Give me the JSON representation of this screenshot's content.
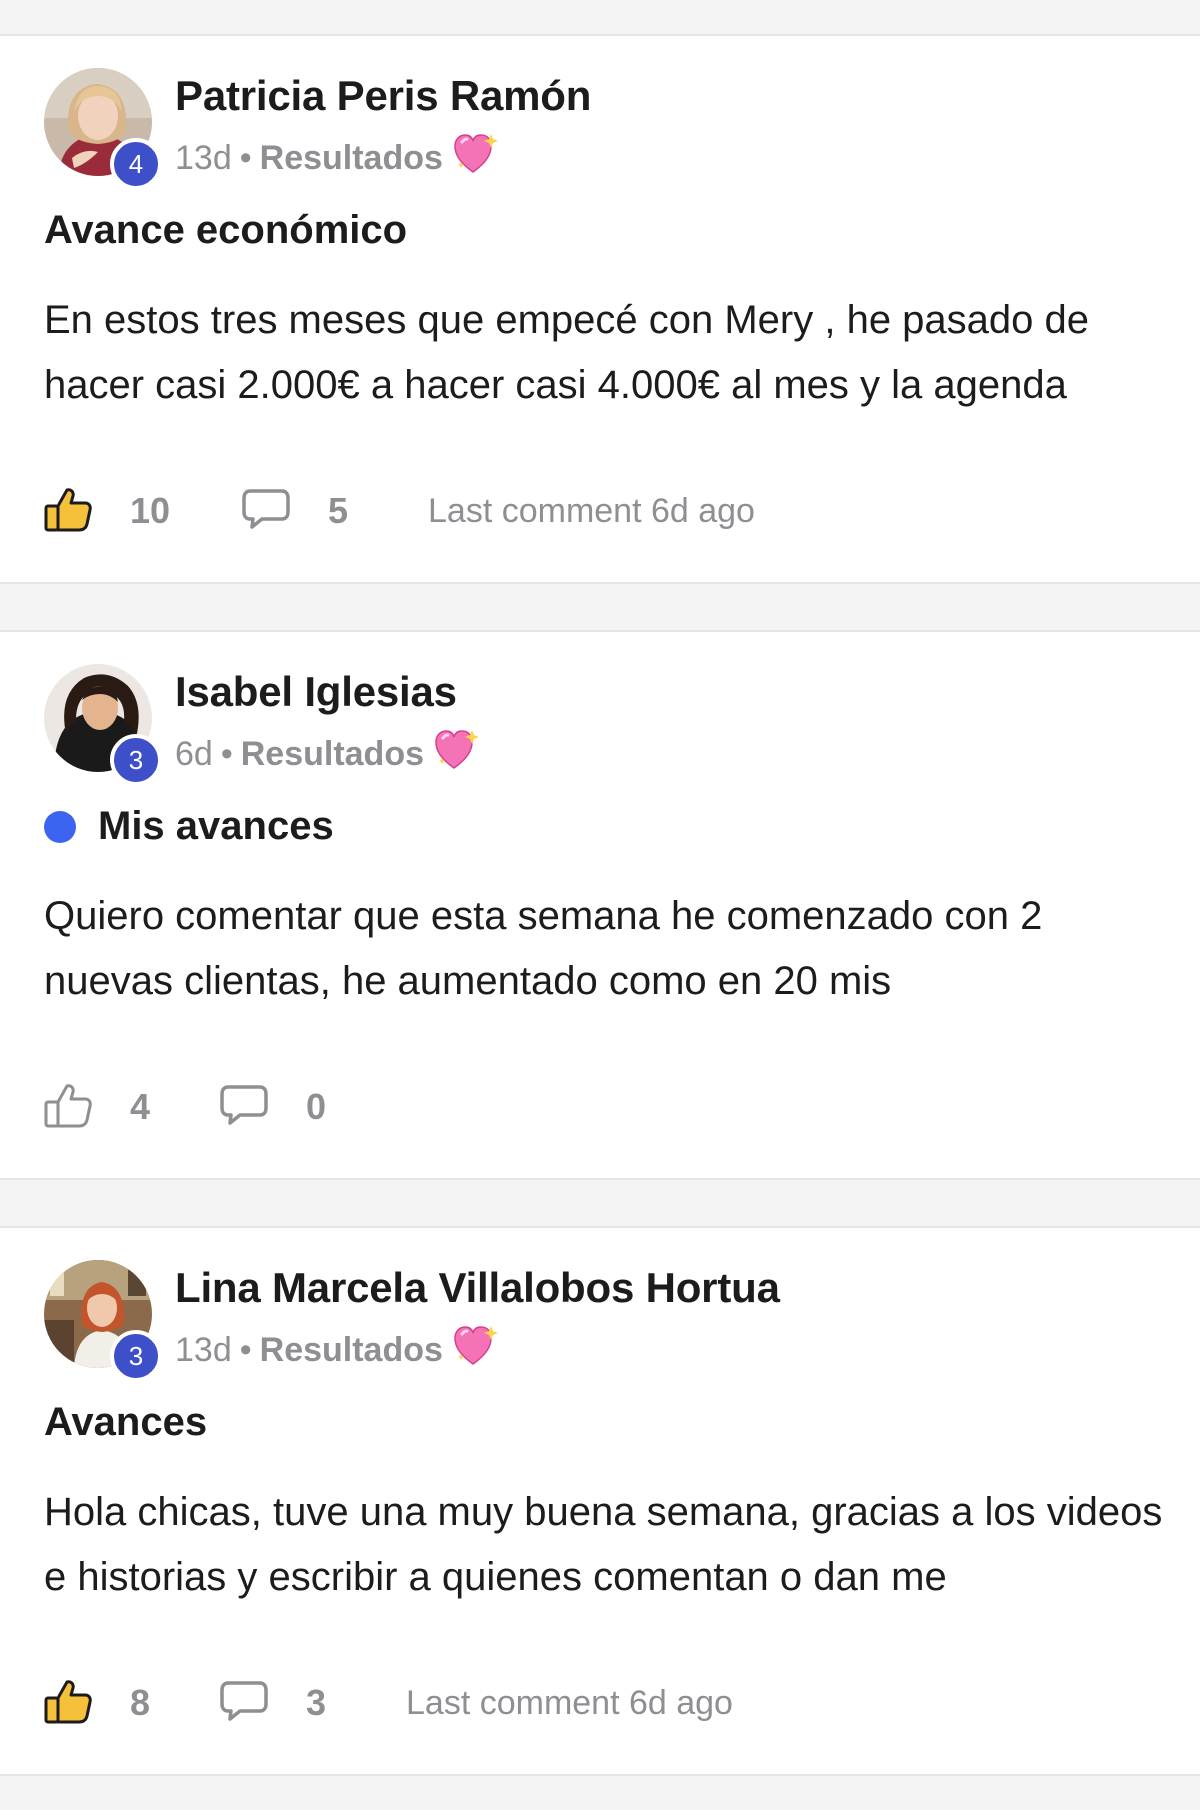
{
  "posts": [
    {
      "author": "Patricia Peris Ramón",
      "level": "4",
      "time": "13d",
      "separator": "•",
      "category": "Resultados",
      "category_emoji": "sparkling-heart-icon",
      "title": "Avance económico",
      "unread": false,
      "body": "En estos tres meses que empecé con Mery , he pasado de hacer casi 2.000€ a hacer casi 4.000€ al mes y la agenda",
      "likes": "10",
      "liked": true,
      "comments": "5",
      "last_comment": "Last comment 6d ago"
    },
    {
      "author": "Isabel Iglesias",
      "level": "3",
      "time": "6d",
      "separator": "•",
      "category": "Resultados",
      "category_emoji": "sparkling-heart-icon",
      "title": "Mis avances",
      "unread": true,
      "body": "Quiero comentar que esta semana he comenzado con 2 nuevas clientas, he aumentado como en 20 mis",
      "likes": "4",
      "liked": false,
      "comments": "0",
      "last_comment": ""
    },
    {
      "author": "Lina Marcela Villalobos Hortua",
      "level": "3",
      "time": "13d",
      "separator": "•",
      "category": "Resultados",
      "category_emoji": "sparkling-heart-icon",
      "title": "Avances",
      "unread": false,
      "body": "Hola chicas, tuve una muy buena semana, gracias a los videos e historias y escribir a quienes comentan o dan me",
      "likes": "8",
      "liked": true,
      "comments": "3",
      "last_comment": "Last comment 6d ago"
    }
  ],
  "colors": {
    "badge": "#3d4fc9",
    "unread_dot": "#3c64f0",
    "liked_thumb": "#f5c13a",
    "muted_text": "#8e8e93",
    "heart": "#f472b6"
  }
}
